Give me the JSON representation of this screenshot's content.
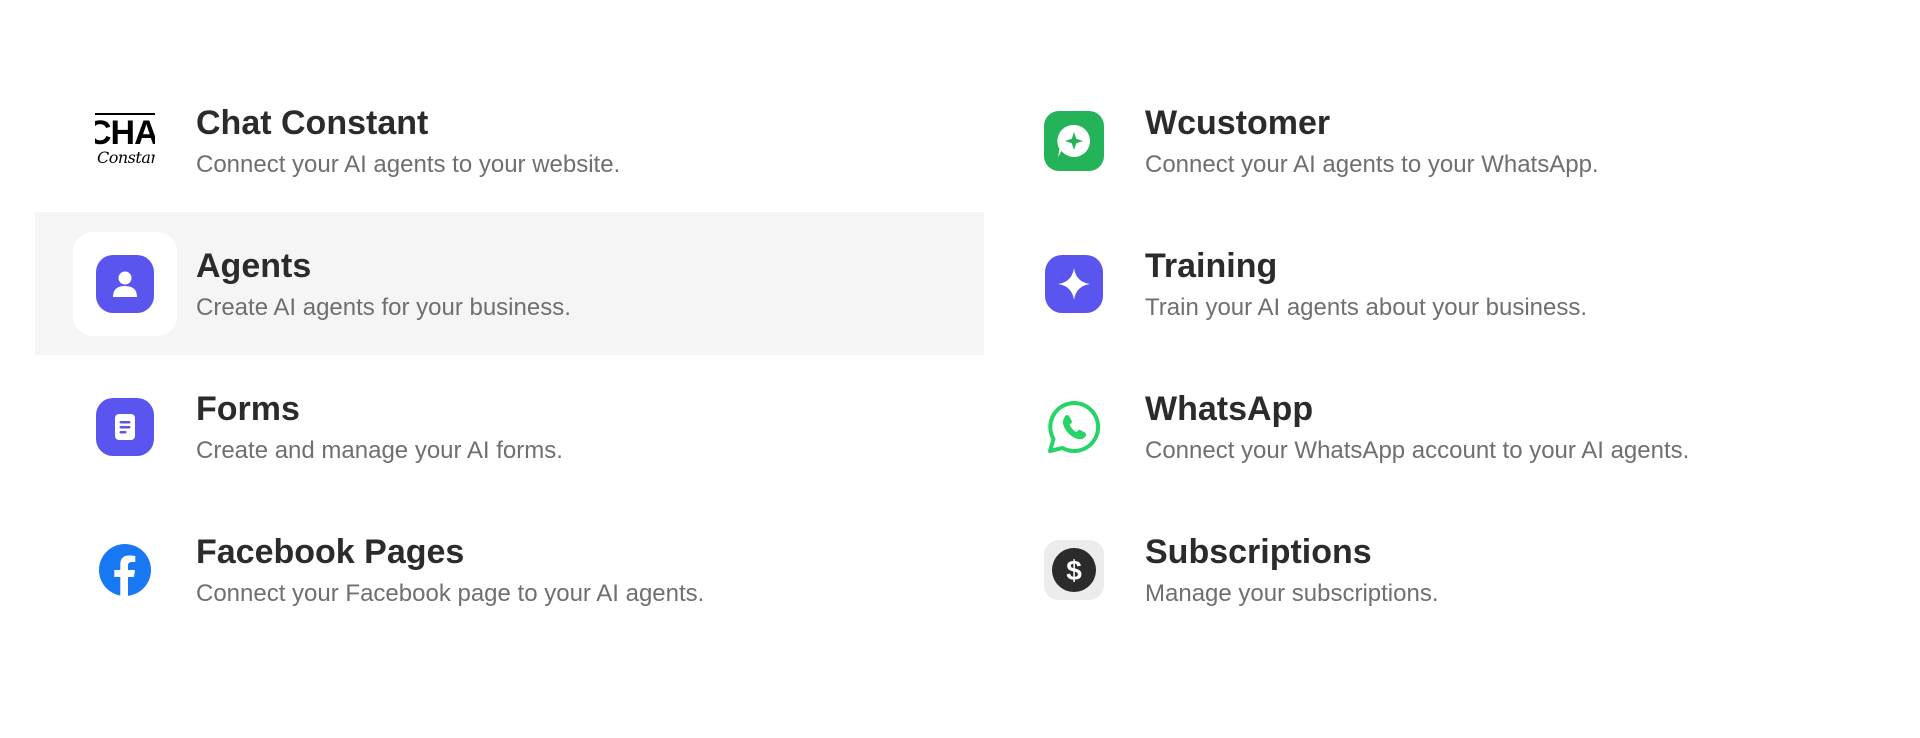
{
  "items": [
    {
      "title": "Chat Constant",
      "description": "Connect your AI agents to your website.",
      "icon": "chat-constant-logo",
      "logo_text": "CHA",
      "logo_script": "Constant"
    },
    {
      "title": "Wcustomer",
      "description": "Connect your AI agents to your WhatsApp.",
      "icon": "wcustomer-icon",
      "color": "#25b35a"
    },
    {
      "title": "Agents",
      "description": "Create AI agents for your business.",
      "icon": "user-icon",
      "color": "#5b55f0"
    },
    {
      "title": "Training",
      "description": "Train your AI agents about your business.",
      "icon": "sparkle-icon",
      "color": "#5b55f0"
    },
    {
      "title": "Forms",
      "description": "Create and manage your AI forms.",
      "icon": "document-icon",
      "color": "#5b55f0"
    },
    {
      "title": "WhatsApp",
      "description": "Connect your WhatsApp account to your AI agents.",
      "icon": "whatsapp-icon",
      "color": "#25d366"
    },
    {
      "title": "Facebook Pages",
      "description": "Connect your Facebook page to your AI agents.",
      "icon": "facebook-icon",
      "color": "#1877f2"
    },
    {
      "title": "Subscriptions",
      "description": "Manage your subscriptions.",
      "icon": "dollar-icon",
      "color": "#2b2b2b"
    }
  ]
}
